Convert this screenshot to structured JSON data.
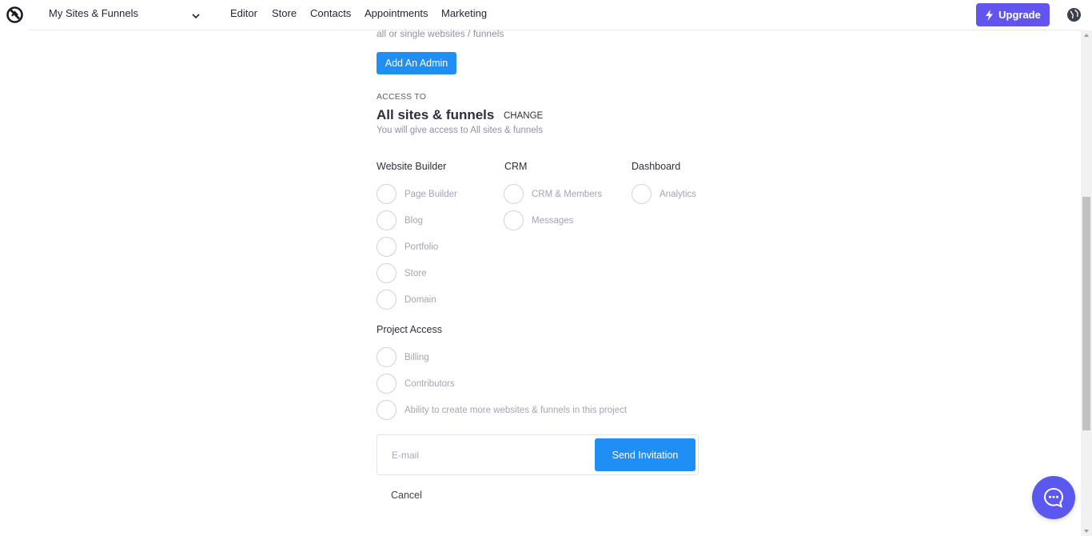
{
  "header": {
    "site_selector": "My Sites & Funnels",
    "nav": [
      "Editor",
      "Store",
      "Contacts",
      "Appointments",
      "Marketing"
    ],
    "upgrade_label": "Upgrade"
  },
  "intro_text": "all or single websites / funnels",
  "add_admin_label": "Add An Admin",
  "access": {
    "heading": "ACCESS TO",
    "title": "All sites & funnels",
    "change_label": "CHANGE",
    "description": "You will give access to All sites & funnels"
  },
  "groups": {
    "website_builder": {
      "title": "Website Builder",
      "items": [
        "Page Builder",
        "Blog",
        "Portfolio",
        "Store",
        "Domain"
      ]
    },
    "crm": {
      "title": "CRM",
      "items": [
        "CRM & Members",
        "Messages"
      ]
    },
    "dashboard": {
      "title": "Dashboard",
      "items": [
        "Analytics"
      ]
    },
    "project_access": {
      "title": "Project Access",
      "items": [
        "Billing",
        "Contributors",
        "Ability to create more websites & funnels in this project"
      ]
    }
  },
  "invite": {
    "email_placeholder": "E-mail",
    "send_label": "Send Invitation",
    "cancel_label": "Cancel"
  },
  "colors": {
    "primary": "#1f8ff5",
    "upgrade": "#6254ee",
    "chat": "#5b58f0"
  }
}
